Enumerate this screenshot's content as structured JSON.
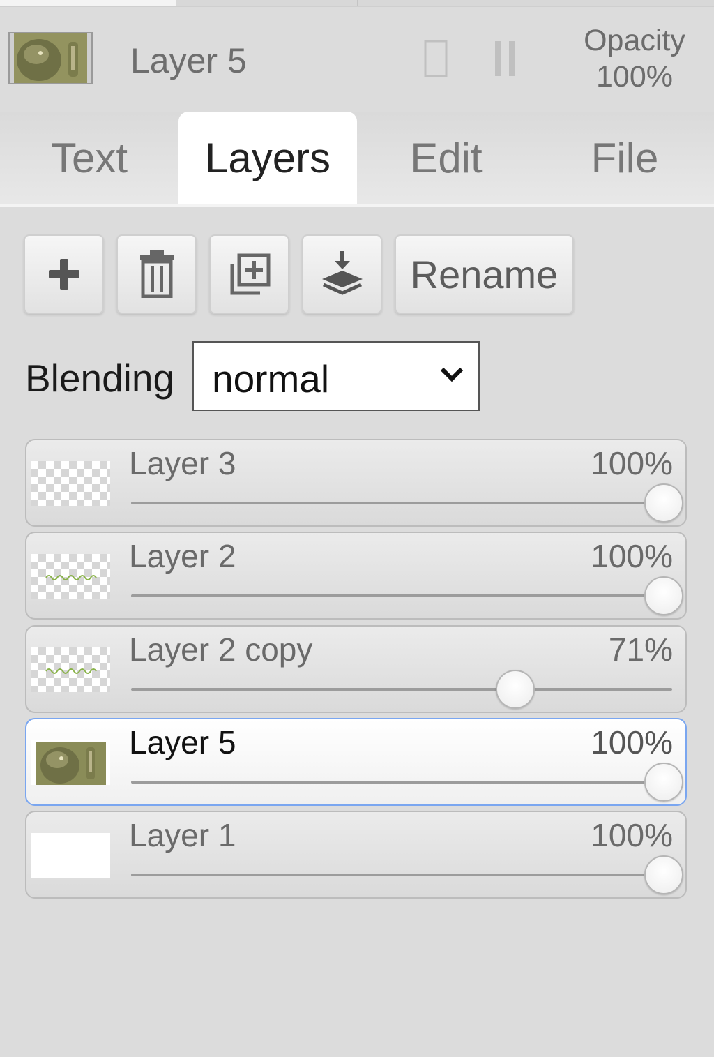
{
  "header": {
    "layer_name": "Layer 5",
    "opacity_label": "Opacity",
    "opacity_value": "100%"
  },
  "tabs": [
    {
      "label": "Text",
      "active": false
    },
    {
      "label": "Layers",
      "active": true
    },
    {
      "label": "Edit",
      "active": false
    },
    {
      "label": "File",
      "active": false
    }
  ],
  "toolbar": {
    "add_icon": "plus-icon",
    "delete_icon": "trash-icon",
    "duplicate_icon": "duplicate-icon",
    "merge_icon": "merge-down-icon",
    "rename_label": "Rename"
  },
  "blending": {
    "label": "Blending",
    "value": "normal"
  },
  "layers": [
    {
      "name": "Layer 3",
      "opacity_label": "100%",
      "opacity": 1.0,
      "thumb": "transparent",
      "selected": false
    },
    {
      "name": "Layer 2",
      "opacity_label": "100%",
      "opacity": 1.0,
      "thumb": "green-text",
      "selected": false
    },
    {
      "name": "Layer 2 copy",
      "opacity_label": "71%",
      "opacity": 0.71,
      "thumb": "green-text",
      "selected": false
    },
    {
      "name": "Layer 5",
      "opacity_label": "100%",
      "opacity": 1.0,
      "thumb": "photo",
      "selected": true
    },
    {
      "name": "Layer 1",
      "opacity_label": "100%",
      "opacity": 1.0,
      "thumb": "white",
      "selected": false
    }
  ],
  "colors": {
    "background": "#dcdcdc",
    "active_tab": "#ffffff",
    "selected_border": "#7aa6f0",
    "thumb_green": "#8ab34a"
  }
}
